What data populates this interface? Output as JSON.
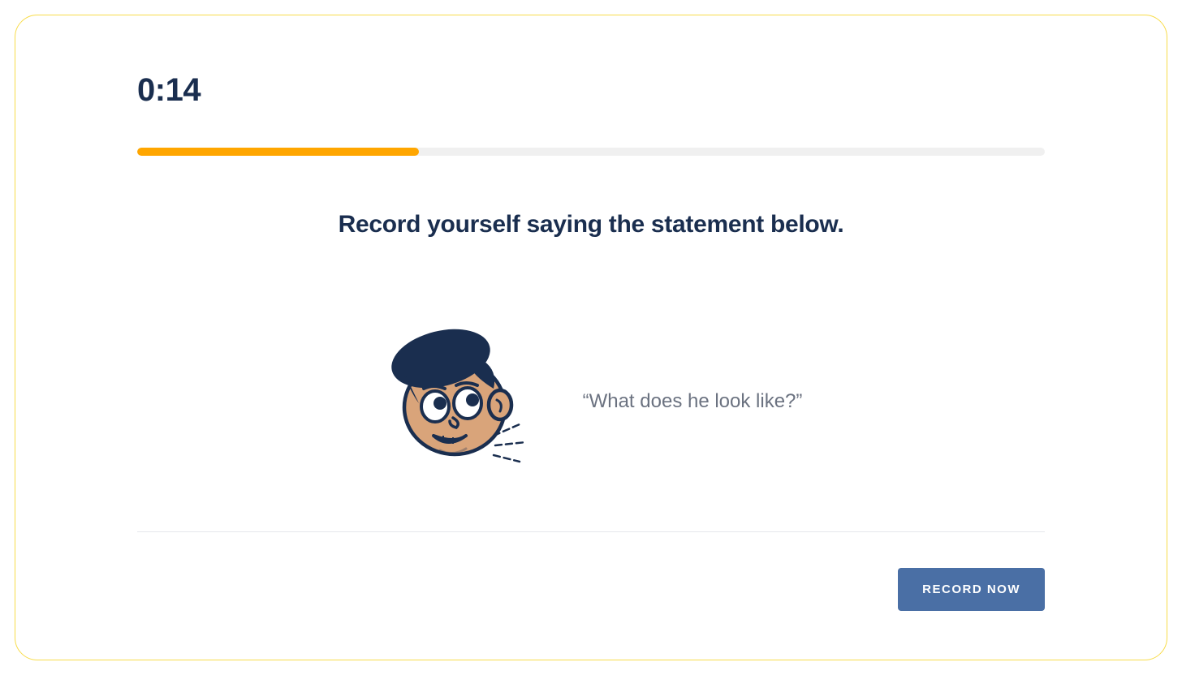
{
  "timer": {
    "display": "0:14"
  },
  "progress": {
    "percent": 31
  },
  "instruction": "Record yourself saying the statement below.",
  "statement": {
    "text": "“What does he look like?”"
  },
  "actions": {
    "record_label": "RECORD NOW"
  },
  "colors": {
    "accent": "#FFA600",
    "border": "#F8DC4A",
    "primary_text": "#1A2E4F",
    "muted_text": "#6B7280",
    "button": "#4A6FA5"
  }
}
